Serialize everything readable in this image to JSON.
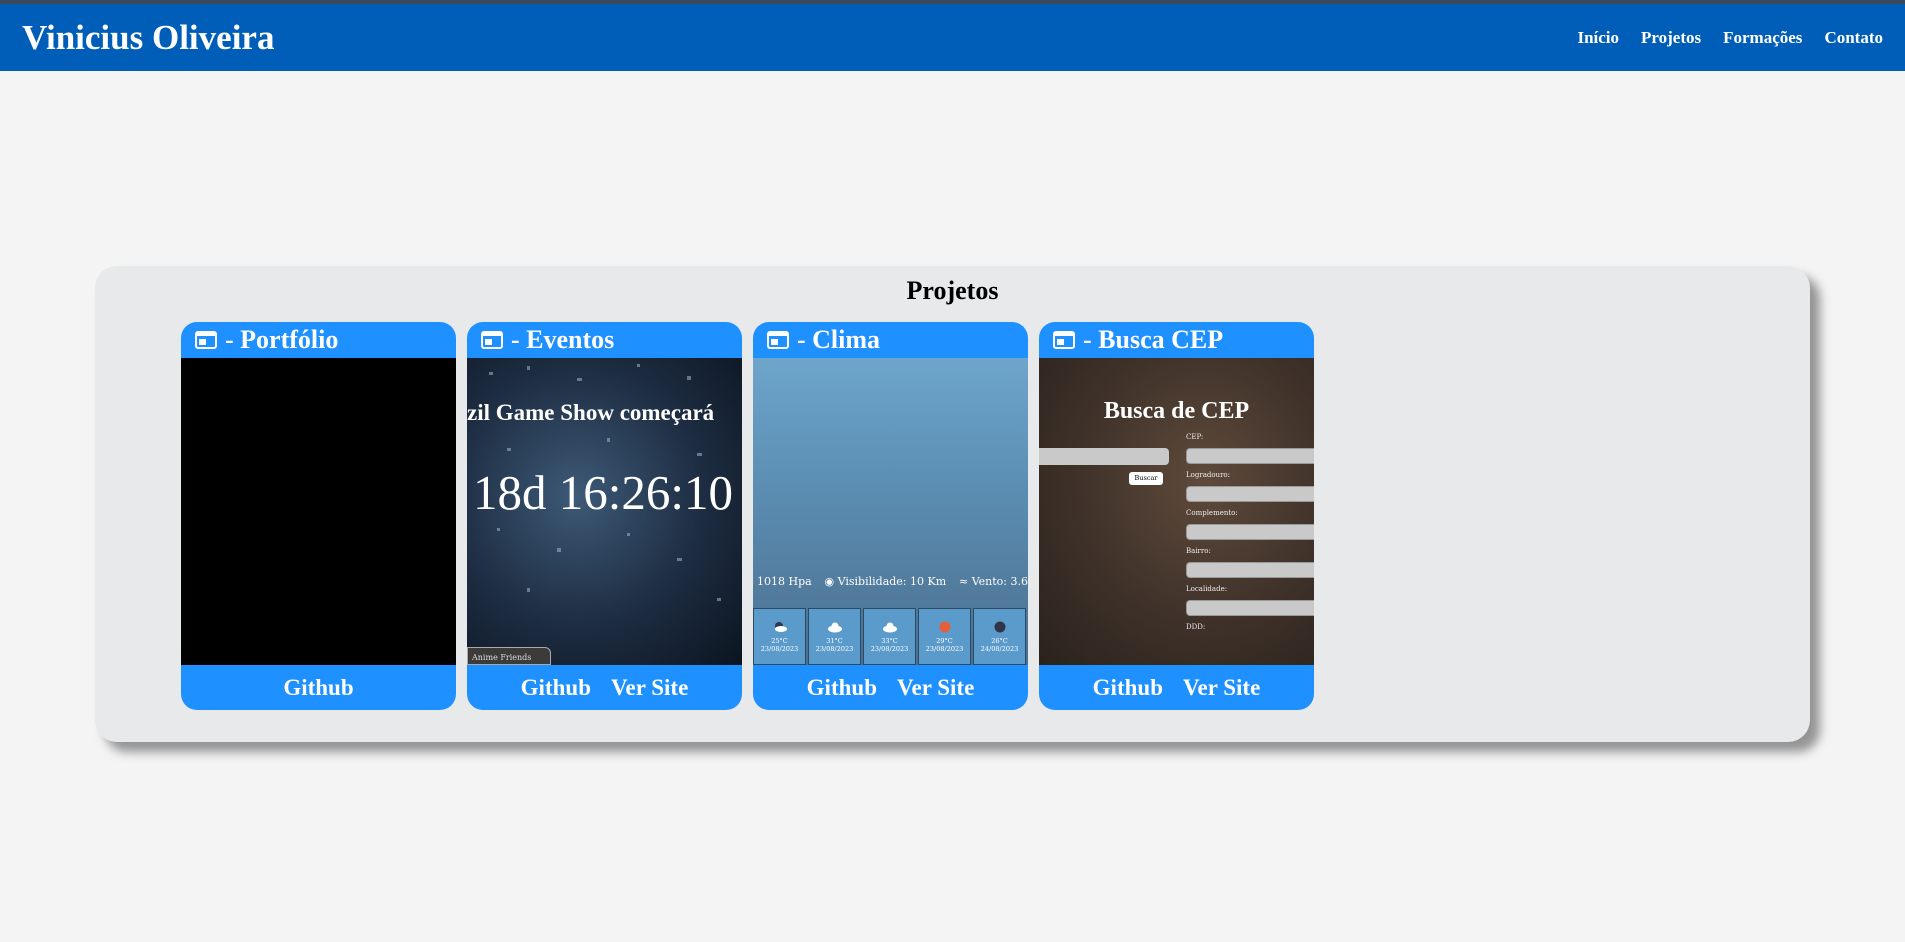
{
  "header": {
    "brand": "Vinicius Oliveira",
    "nav": [
      "Início",
      "Projetos",
      "Formações",
      "Contato"
    ]
  },
  "section": {
    "title": "Projetos"
  },
  "cards": [
    {
      "title": "- Portfólio",
      "links": [
        "Github"
      ]
    },
    {
      "title": "- Eventos",
      "links": [
        "Github",
        "Ver Site"
      ],
      "preview": {
        "headline": "zil Game Show começará",
        "countdown": "18d 16:26:10",
        "button": "Anime Friends"
      }
    },
    {
      "title": "- Clima",
      "links": [
        "Github",
        "Ver Site"
      ],
      "preview": {
        "pressure": "1018 Hpa",
        "visibility": "Visibilidade: 10 Km",
        "wind": "Vento: 3.6",
        "days": [
          {
            "temp": "25°C",
            "date": "23/08/2023",
            "icon": "partly-cloudy-night-icon"
          },
          {
            "temp": "31°C",
            "date": "23/08/2023",
            "icon": "cloud-icon"
          },
          {
            "temp": "33°C",
            "date": "23/08/2023",
            "icon": "cloud-icon"
          },
          {
            "temp": "29°C",
            "date": "23/08/2023",
            "icon": "sun-icon"
          },
          {
            "temp": "26°C",
            "date": "24/08/2023",
            "icon": "moon-icon"
          }
        ]
      }
    },
    {
      "title": "- Busca CEP",
      "links": [
        "Github",
        "Ver Site"
      ],
      "preview": {
        "heading": "Busca de CEP",
        "button": "Buscar",
        "labels": [
          "CEP:",
          "Logradouro:",
          "Complemento:",
          "Bairro:",
          "Localidade:",
          "DDD:"
        ]
      }
    }
  ],
  "colors": {
    "header": "#005eb8",
    "card": "#1e90ff",
    "panel": "#e8e9ea"
  }
}
